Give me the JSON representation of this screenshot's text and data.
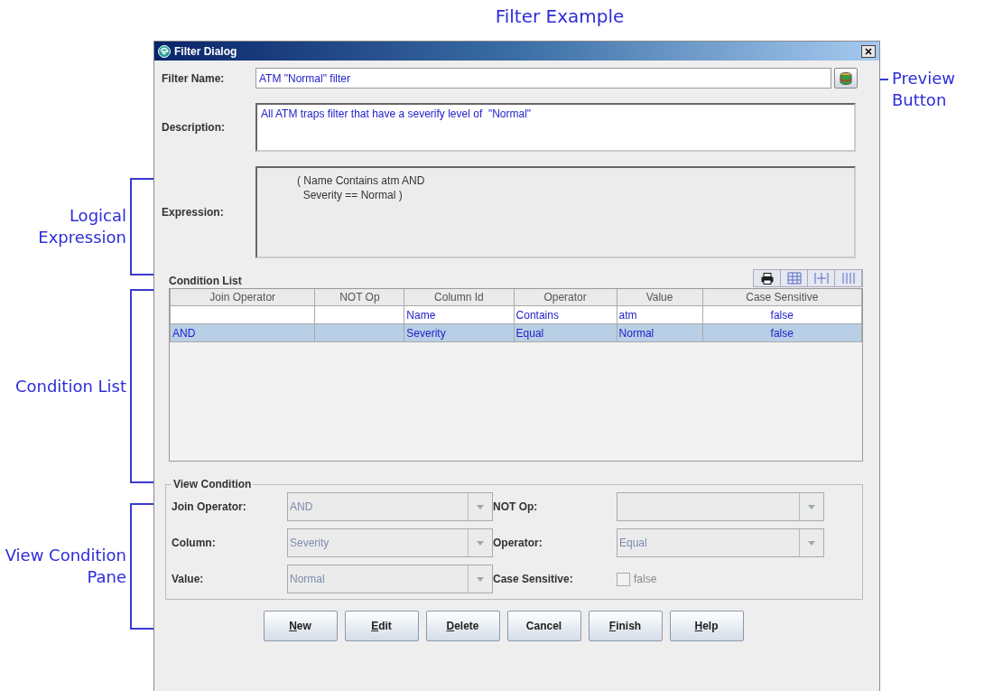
{
  "title": "Filter Example",
  "annotations_left": [
    {
      "text": "Logical Expression"
    },
    {
      "text": "Condition List"
    },
    {
      "text": "View Condition Pane"
    }
  ],
  "annotation_right": {
    "text": "Preview Button"
  },
  "dialog": {
    "title": "Filter Dialog",
    "filter_name": {
      "label": "Filter Name:",
      "value": "ATM \"Normal\" filter"
    },
    "description": {
      "label": "Description:",
      "value": "All ATM traps filter that have a severify level of  \"Normal\""
    },
    "expression": {
      "label": "Expression:",
      "value": "( Name Contains atm AND\n  Severity == Normal )"
    },
    "condition_list": {
      "title": "Condition List",
      "columns": [
        "Join Operator",
        "NOT Op",
        "Column Id",
        "Operator",
        "Value",
        "Case Sensitive"
      ],
      "rows": [
        {
          "cells": [
            "",
            "",
            "Name",
            "Contains",
            "atm",
            "false"
          ],
          "selected": false
        },
        {
          "cells": [
            "AND",
            "",
            "Severity",
            "Equal",
            "Normal",
            "false"
          ],
          "selected": true
        }
      ]
    },
    "view_condition": {
      "title": "View Condition",
      "fields": [
        {
          "kind": "combo",
          "label": "Join Operator:",
          "value": "AND",
          "disabled": true
        },
        {
          "kind": "combo",
          "label": "NOT Op:",
          "disabled": true
        },
        {
          "kind": "combo",
          "label": "Column:",
          "value": "Severity",
          "disabled": true
        },
        {
          "kind": "combo",
          "label": "Operator:",
          "value": "Equal",
          "disabled": true
        },
        {
          "kind": "combo",
          "label": "Value:",
          "value": "Normal",
          "disabled": true
        },
        {
          "kind": "checkbox",
          "label": "Case Sensitive:",
          "value": "false",
          "checked": false,
          "disabled": true
        }
      ]
    },
    "buttons": [
      {
        "label": "New",
        "first_letter_underlined": true
      },
      {
        "label": "Edit",
        "first_letter_underlined": true
      },
      {
        "label": "Delete",
        "first_letter_underlined": true
      },
      {
        "label": "Cancel",
        "first_letter_underlined": false
      },
      {
        "label": "Finish",
        "first_letter_underlined": true
      },
      {
        "label": "Help",
        "first_letter_underlined": true
      }
    ]
  }
}
